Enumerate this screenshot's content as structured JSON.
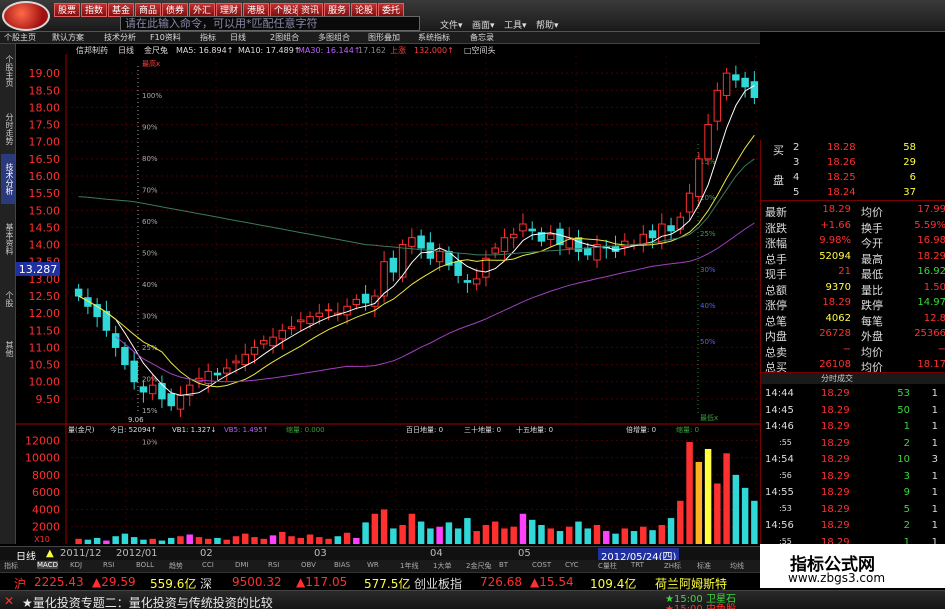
{
  "topbar": {
    "buttons": [
      "股票",
      "指数",
      "基金",
      "商品",
      "债券",
      "外汇",
      "理财",
      "港股",
      "个股通",
      "资讯",
      "服务",
      "论股",
      "委托"
    ],
    "command_placeholder": "请在此输入命令，可以用*匹配任意字符",
    "menu": [
      "文件",
      "画面",
      "工具",
      "帮助"
    ]
  },
  "toolbar2": {
    "items": [
      "个股主页",
      "默认方案",
      "技术分析",
      "F10资料",
      "指标",
      "日线",
      "2图组合",
      "多图组合",
      "图形叠加",
      "系统指标",
      "备忘录"
    ]
  },
  "lefttabs": [
    "个股主页",
    "分时走势",
    "技术分析",
    "基本资料",
    "个股",
    "其他"
  ],
  "main_legend": {
    "stock": "信邦制药",
    "period": "日线",
    "indicator": "金尺兔",
    "ma5": "MA5: 16.894↑",
    "ma10": "MA10: 17.489↑",
    "ma30": "MA30: 16.144↑",
    "extra": "17.162",
    "up": "上涨",
    "price_tag": "132.000↑",
    "box": "□空间头"
  },
  "chart_data": [
    {
      "type": "candlestick",
      "panel": "price",
      "ylim": [
        9.0,
        19.5
      ],
      "yticks": [
        "19.00",
        "18.50",
        "18.00",
        "17.50",
        "17.00",
        "16.50",
        "16.00",
        "15.50",
        "15.00",
        "14.50",
        "14.00",
        "13.50",
        "13.00",
        "12.50",
        "12.00",
        "11.50",
        "11.00",
        "10.50",
        "10.00",
        "9.50"
      ],
      "current_price_label": "13.287",
      "pct_scale_left": [
        "100%",
        "90%",
        "80%",
        "70%",
        "60%",
        "50%",
        "40%",
        "30%",
        "25%",
        "20%",
        "15%",
        "10%"
      ],
      "pct_scale_right": [
        "15%",
        "20%",
        "25%",
        "30%",
        "40%",
        "50%"
      ],
      "top_label": "最高x",
      "bottom_label": "最低x",
      "left_bottom_label": "9.06",
      "closes": [
        12.5,
        12.2,
        11.9,
        11.5,
        11.0,
        10.5,
        10.0,
        9.7,
        9.9,
        9.5,
        9.3,
        9.6,
        9.9,
        10.1,
        10.3,
        10.2,
        10.4,
        10.6,
        10.8,
        11.0,
        11.2,
        11.3,
        11.5,
        11.6,
        11.8,
        11.9,
        12.0,
        12.1,
        12.0,
        12.2,
        12.4,
        12.3,
        12.5,
        13.5,
        13.2,
        14.0,
        14.2,
        13.9,
        13.6,
        13.8,
        13.4,
        13.1,
        12.9,
        13.0,
        13.6,
        13.9,
        14.2,
        14.3,
        14.6,
        14.4,
        14.1,
        14.3,
        14.0,
        14.2,
        13.8,
        13.7,
        14.0,
        13.9,
        13.8,
        14.1,
        14.0,
        14.3,
        14.2,
        14.6,
        14.4,
        14.8,
        15.5,
        16.5,
        17.5,
        18.5,
        19.0,
        18.8,
        18.6,
        18.29
      ],
      "ma_long": [
        15.4,
        15.38,
        15.35,
        15.32,
        15.3,
        15.28,
        15.25,
        15.2,
        15.15,
        15.1,
        15.05,
        15.0,
        14.95,
        14.9,
        14.85,
        14.8,
        14.75,
        14.7,
        14.65,
        14.6,
        14.55,
        14.5,
        14.45,
        14.4,
        14.35,
        14.3,
        14.25,
        14.2,
        14.15,
        14.1,
        14.05,
        14.0,
        13.98,
        13.95,
        13.93,
        13.9,
        13.88,
        13.85,
        13.83,
        13.8,
        13.78,
        13.75,
        13.73,
        13.7,
        13.7,
        13.7,
        13.72,
        13.74,
        13.76,
        13.78,
        13.8,
        13.82,
        13.84,
        13.86,
        13.88,
        13.9,
        13.92,
        13.94,
        13.96,
        13.98,
        14.0,
        14.02,
        14.05,
        14.1,
        14.15,
        14.2,
        14.3,
        14.5,
        14.8,
        15.2,
        15.6,
        16.0,
        16.3,
        16.5
      ]
    },
    {
      "type": "bar",
      "panel": "volume",
      "ylim": [
        0,
        12500
      ],
      "yticks": [
        "12000",
        "10000",
        "8000",
        "6000",
        "4000",
        "2000"
      ],
      "multiplier_label": "X10",
      "header": {
        "name": "量(金尺)",
        "today": "今日: 52094↑",
        "vb": "VB1: 1.327↓",
        "vb5": "VB5: 1.495↑",
        "weekly": "缩量: 0.000",
        "hundred": "百日地量: 0",
        "thirty": "三十地量: 0",
        "fifteen": "十五地量: 0",
        "double": "倍增量: 0",
        "super": "缩量: 0"
      },
      "values": [
        600,
        500,
        700,
        400,
        900,
        1200,
        800,
        500,
        600,
        400,
        700,
        900,
        1100,
        800,
        600,
        700,
        500,
        900,
        1200,
        800,
        600,
        1000,
        1400,
        900,
        700,
        1100,
        800,
        600,
        900,
        1300,
        700,
        2500,
        3500,
        4000,
        1800,
        2200,
        3500,
        2600,
        1800,
        2000,
        2500,
        1800,
        3000,
        1500,
        2200,
        2600,
        1800,
        2000,
        3500,
        2800,
        2200,
        1800,
        1500,
        2000,
        2600,
        1800,
        2200,
        1500,
        1200,
        1800,
        1500,
        2000,
        1600,
        2200,
        3000,
        5000,
        11800,
        9500,
        11000,
        7000,
        10500,
        8000,
        6500,
        5000
      ]
    }
  ],
  "dates": [
    "日线",
    "2011/12",
    "2012/01",
    "02",
    "03",
    "04",
    "05",
    "2012/05/24(四)"
  ],
  "bottom_tabs": [
    "指标",
    "MACD",
    "KDJ",
    "RSI",
    "BOLL",
    "趋势",
    "CCI",
    "DMI",
    "RSI",
    "OBV",
    "BIAS",
    "WR",
    "1年线",
    "1大单",
    "2金尺兔",
    "BT",
    "COST",
    "CYC",
    "C量柱",
    "TRT",
    "ZH标",
    "标准",
    "均线"
  ],
  "right_panel": {
    "buy_label": "买",
    "pan_label": "盘",
    "bids": [
      {
        "n": "2",
        "price": "18.28",
        "vol": "58"
      },
      {
        "n": "3",
        "price": "18.26",
        "vol": "29"
      },
      {
        "n": "4",
        "price": "18.25",
        "vol": "6"
      },
      {
        "n": "5",
        "price": "18.24",
        "vol": "37"
      }
    ],
    "stats": [
      {
        "k1": "最新",
        "v1": "18.29",
        "k2": "均价",
        "v2": "17.99"
      },
      {
        "k1": "涨跌",
        "v1": "+1.66",
        "k2": "换手",
        "v2": "5.59%"
      },
      {
        "k1": "涨幅",
        "v1": "9.98%",
        "k2": "今开",
        "v2": "16.98"
      },
      {
        "k1": "总手",
        "v1": "52094",
        "k2": "最高",
        "v2": "18.29"
      },
      {
        "k1": "现手",
        "v1": "21",
        "k2": "最低",
        "v2": "16.92"
      },
      {
        "k1": "总额",
        "v1": "9370",
        "k2": "量比",
        "v2": "1.50"
      },
      {
        "k1": "涨停",
        "v1": "18.29",
        "k2": "跌停",
        "v2": "14.97"
      },
      {
        "k1": "总笔",
        "v1": "4062",
        "k2": "每笔",
        "v2": "12.8"
      },
      {
        "k1": "内盘",
        "v1": "26728",
        "k2": "外盘",
        "v2": "25366"
      },
      {
        "k1": "总卖",
        "v1": "−",
        "k2": "均价",
        "v2": "−"
      },
      {
        "k1": "总买",
        "v1": "26108",
        "k2": "均价",
        "v2": "18.17"
      }
    ],
    "ticks_title": "分时成交",
    "ticks": [
      {
        "t": "14:44",
        "p": "18.29",
        "v": "53",
        "c": "1"
      },
      {
        "t": "14:45",
        "p": "18.29",
        "v": "50",
        "c": "1"
      },
      {
        "t": "14:46",
        "p": "18.29",
        "v": "1",
        "c": "1"
      },
      {
        "t": ":55",
        "p": "18.29",
        "v": "2",
        "c": "1"
      },
      {
        "t": "14:54",
        "p": "18.29",
        "v": "10",
        "c": "3"
      },
      {
        "t": ":56",
        "p": "18.29",
        "v": "3",
        "c": "1"
      },
      {
        "t": "14:55",
        "p": "18.29",
        "v": "9",
        "c": "1"
      },
      {
        "t": ":53",
        "p": "18.29",
        "v": "5",
        "c": "1"
      },
      {
        "t": "14:56",
        "p": "18.29",
        "v": "2",
        "c": "1"
      },
      {
        "t": ":55",
        "p": "18.29",
        "v": "1",
        "c": "1"
      }
    ]
  },
  "index_bar": [
    {
      "name": "沪",
      "value": "2225.43",
      "change": "▲29.59",
      "amount": "559.6亿",
      "name2": "深",
      "value2": "9500.32",
      "change2": "▲117.05",
      "amount2": "577.5亿",
      "name3": "创业板指",
      "value3": "726.68",
      "change3": "▲15.54",
      "amount3": "109.4亿"
    }
  ],
  "news": {
    "text": "★量化投资专题二：量化投资与传统投资的比较",
    "right_top": "荷兰阿姆斯特",
    "right1": "★15:00 卫星石",
    "right2": "★15:00 中色股"
  },
  "watermark": {
    "line1": "指标公式网",
    "line2": "www.zbgs3.com"
  }
}
